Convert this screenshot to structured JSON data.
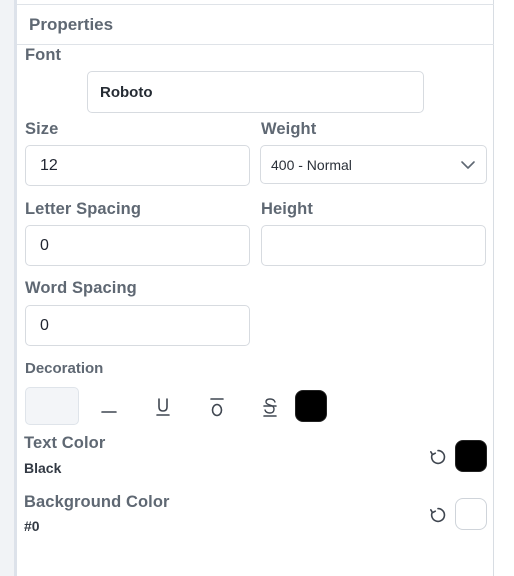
{
  "panel": {
    "title": "Properties"
  },
  "font": {
    "label": "Font",
    "value": "Roboto"
  },
  "size": {
    "label": "Size",
    "value": "12"
  },
  "weight": {
    "label": "Weight",
    "selected": "400 - Normal"
  },
  "letter_spacing": {
    "label": "Letter Spacing",
    "value": "0"
  },
  "height": {
    "label": "Height",
    "value": ""
  },
  "word_spacing": {
    "label": "Word Spacing",
    "value": "0"
  },
  "decoration": {
    "label": "Decoration",
    "options": [
      "none",
      "line-through-dash",
      "underline",
      "overline",
      "strikethrough"
    ],
    "swatch_color": "#000000"
  },
  "text_color": {
    "label": "Text Color",
    "value_text": "Black",
    "swatch_color": "#000000",
    "reset_icon": "reset-icon"
  },
  "background_color": {
    "label": "Background Color",
    "value_text": "#0",
    "swatch_color": "#ffffff",
    "reset_icon": "reset-icon"
  }
}
